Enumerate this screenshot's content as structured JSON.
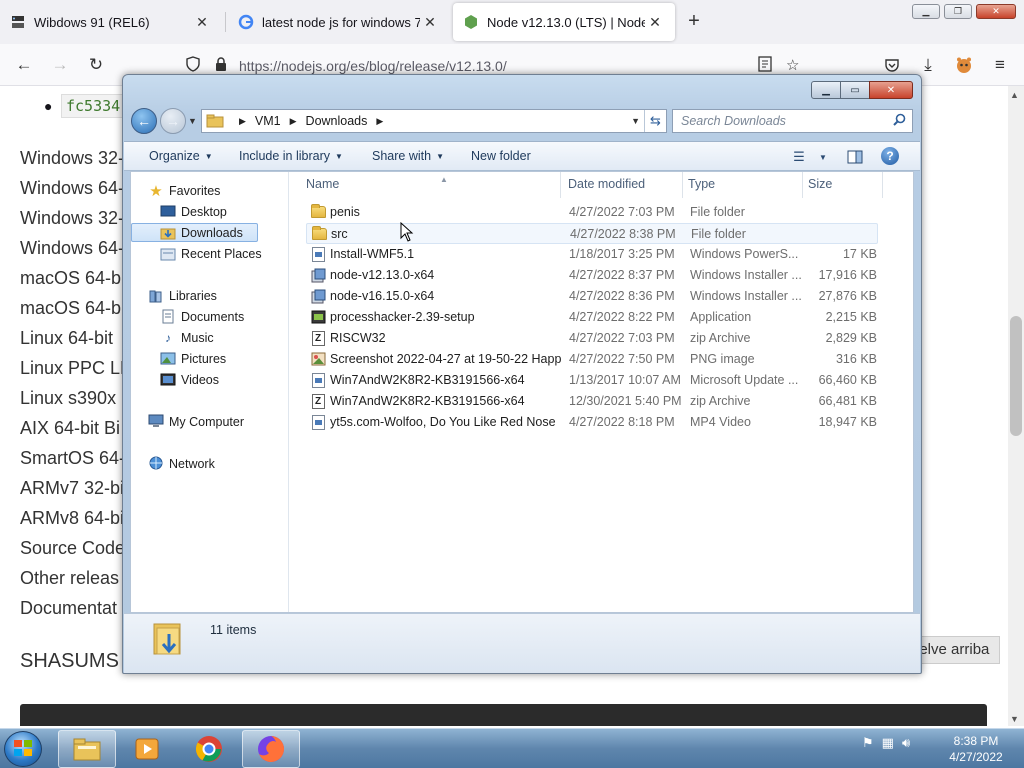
{
  "browser": {
    "tabs": [
      {
        "title": "Wibdows 91 (REL6)",
        "icon": "server-icon"
      },
      {
        "title": "latest node js for windows 7 - G",
        "icon": "google-icon"
      },
      {
        "title": "Node v12.13.0 (LTS) | Node.js",
        "icon": "nodejs-icon"
      }
    ],
    "new_tab": "+",
    "url": "https://nodejs.org/es/blog/release/v12.13.0/"
  },
  "page": {
    "hash_text": "fc5334",
    "downloads": [
      "Windows 32-",
      "Windows 64-",
      "Windows 32-",
      "Windows 64-",
      "macOS 64-bi",
      "macOS 64-bi",
      "Linux 64-bit",
      "Linux PPC LE",
      "Linux s390x",
      "AIX 64-bit Bi",
      "SmartOS 64-",
      "ARMv7 32-bi",
      "ARMv8 64-bi",
      "Source Code",
      "Other releas",
      "Documentat"
    ],
    "shasums_heading": "SHASUMS",
    "back_to_top": "uelve arriba"
  },
  "explorer": {
    "breadcrumb": [
      "VM1",
      "Downloads"
    ],
    "search_placeholder": "Search Downloads",
    "toolbar": {
      "organize": "Organize",
      "include_in_library": "Include in library",
      "share_with": "Share with",
      "new_folder": "New folder"
    },
    "nav_pane": {
      "favorites": "Favorites",
      "favorites_items": [
        "Desktop",
        "Downloads",
        "Recent Places"
      ],
      "libraries": "Libraries",
      "libraries_items": [
        "Documents",
        "Music",
        "Pictures",
        "Videos"
      ],
      "my_computer": "My Computer",
      "network": "Network"
    },
    "columns": {
      "name": "Name",
      "date": "Date modified",
      "type": "Type",
      "size": "Size"
    },
    "files": [
      {
        "name": "penis",
        "date": "4/27/2022 7:03 PM",
        "type": "File folder",
        "size": "",
        "icon": "folder-icon"
      },
      {
        "name": "src",
        "date": "4/27/2022 8:38 PM",
        "type": "File folder",
        "size": "",
        "icon": "folder-icon"
      },
      {
        "name": "Install-WMF5.1",
        "date": "1/18/2017 3:25 PM",
        "type": "Windows PowerS...",
        "size": "17 KB",
        "icon": "powershell-script-icon"
      },
      {
        "name": "node-v12.13.0-x64",
        "date": "4/27/2022 8:37 PM",
        "type": "Windows Installer ...",
        "size": "17,916 KB",
        "icon": "msi-installer-icon"
      },
      {
        "name": "node-v16.15.0-x64",
        "date": "4/27/2022 8:36 PM",
        "type": "Windows Installer ...",
        "size": "27,876 KB",
        "icon": "msi-installer-icon"
      },
      {
        "name": "processhacker-2.39-setup",
        "date": "4/27/2022 8:22 PM",
        "type": "Application",
        "size": "2,215 KB",
        "icon": "application-icon"
      },
      {
        "name": "RISCW32",
        "date": "4/27/2022 7:03 PM",
        "type": "zip Archive",
        "size": "2,829 KB",
        "icon": "zip-archive-icon"
      },
      {
        "name": "Screenshot 2022-04-27 at 19-50-22 Happ...",
        "date": "4/27/2022 7:50 PM",
        "type": "PNG image",
        "size": "316 KB",
        "icon": "png-image-icon"
      },
      {
        "name": "Win7AndW2K8R2-KB3191566-x64",
        "date": "1/13/2017 10:07 AM",
        "type": "Microsoft Update ...",
        "size": "66,460 KB",
        "icon": "msu-update-icon"
      },
      {
        "name": "Win7AndW2K8R2-KB3191566-x64",
        "date": "12/30/2021 5:40 PM",
        "type": "zip Archive",
        "size": "66,481 KB",
        "icon": "zip-archive-icon"
      },
      {
        "name": "yt5s.com-Wolfoo, Do You Like Red Nose",
        "date": "4/27/2022 8:18 PM",
        "type": "MP4 Video",
        "size": "18,947 KB",
        "icon": "mp4-video-icon"
      }
    ],
    "item_count": "11 items"
  },
  "taskbar": {
    "clock_time": "8:38 PM",
    "clock_date": "4/27/2022"
  }
}
